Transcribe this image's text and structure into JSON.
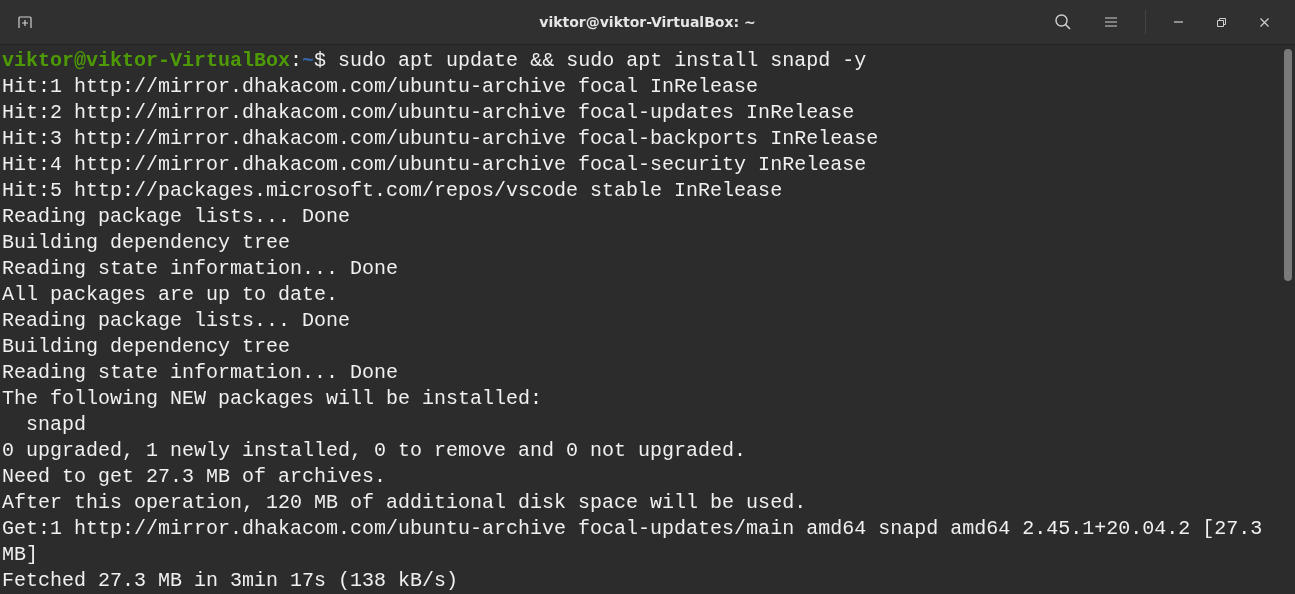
{
  "window": {
    "title": "viktor@viktor-VirtualBox: ~"
  },
  "prompt": {
    "user_host": "viktor@viktor-VirtualBox",
    "separator": ":",
    "path": "~",
    "symbol": "$",
    "command": " sudo apt update && sudo apt install snapd -y"
  },
  "output_lines": [
    "Hit:1 http://mirror.dhakacom.com/ubuntu-archive focal InRelease",
    "Hit:2 http://mirror.dhakacom.com/ubuntu-archive focal-updates InRelease",
    "Hit:3 http://mirror.dhakacom.com/ubuntu-archive focal-backports InRelease",
    "Hit:4 http://mirror.dhakacom.com/ubuntu-archive focal-security InRelease",
    "Hit:5 http://packages.microsoft.com/repos/vscode stable InRelease",
    "Reading package lists... Done",
    "Building dependency tree",
    "Reading state information... Done",
    "All packages are up to date.",
    "Reading package lists... Done",
    "Building dependency tree",
    "Reading state information... Done",
    "The following NEW packages will be installed:",
    "  snapd",
    "0 upgraded, 1 newly installed, 0 to remove and 0 not upgraded.",
    "Need to get 27.3 MB of archives.",
    "After this operation, 120 MB of additional disk space will be used.",
    "Get:1 http://mirror.dhakacom.com/ubuntu-archive focal-updates/main amd64 snapd amd64 2.45.1+20.04.2 [27.3",
    "MB]",
    "Fetched 27.3 MB in 3min 17s (138 kB/s)"
  ]
}
